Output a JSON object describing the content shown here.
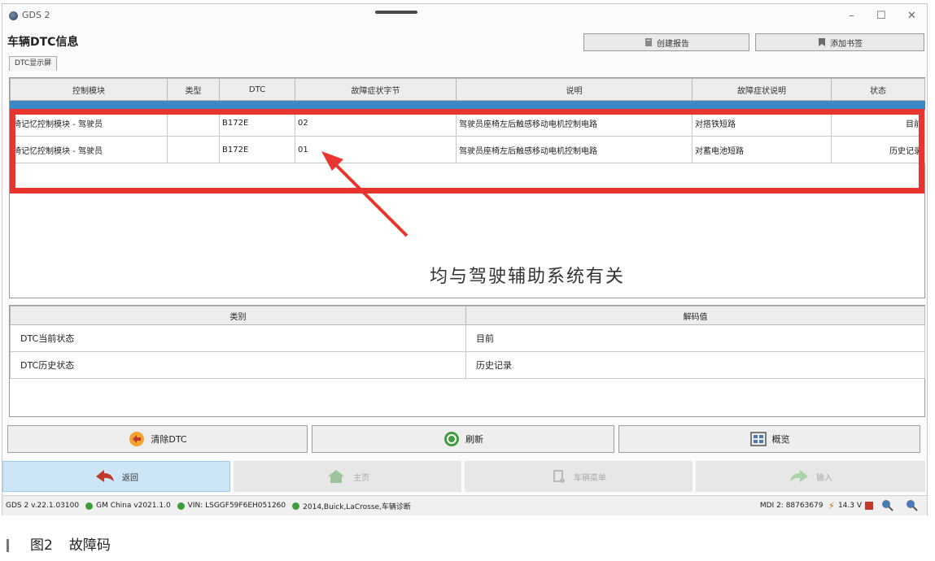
{
  "window": {
    "title": "GDS 2",
    "minimize": "–",
    "maximize": "☐",
    "close": "✕"
  },
  "page_title": "车辆DTC信息",
  "top_buttons": {
    "create_report": "创建报告",
    "add_bookmark": "添加书签"
  },
  "tab_label": "DTC显示屏",
  "dtc_table": {
    "headers": [
      "控制模块",
      "类型",
      "DTC",
      "故障症状字节",
      "说明",
      "故障症状说明",
      "状态"
    ],
    "rows": [
      {
        "module": "椅记忆控制模块 - 驾驶员",
        "type": "",
        "dtc": "B172E",
        "byte": "02",
        "desc": "驾驶员座椅左后触感移动电机控制电路",
        "symptom": "对搭铁短路",
        "status": "目前"
      },
      {
        "module": "椅记忆控制模块 - 驾驶员",
        "type": "",
        "dtc": "B172E",
        "byte": "01",
        "desc": "驾驶员座椅左后触感移动电机控制电路",
        "symptom": "对蓄电池短路",
        "status": "历史记录"
      }
    ]
  },
  "annotation": "均与驾驶辅助系统有关",
  "info_table": {
    "headers": [
      "类别",
      "解码值"
    ],
    "rows": [
      {
        "category": "DTC当前状态",
        "value": "目前"
      },
      {
        "category": "DTC历史状态",
        "value": "历史记录"
      }
    ]
  },
  "actions": {
    "clear": "清除DTC",
    "refresh": "刷新",
    "overview": "概览"
  },
  "nav": {
    "back": "返回",
    "home": "主页",
    "vehicle_menu": "车辆菜单",
    "input": "输入"
  },
  "status": {
    "version": "GDS 2 v.22.1.03100",
    "db": "GM China v2021.1.0",
    "vin": "VIN: LSGGF59F6EH051260",
    "vehicle": "2014,Buick,LaCrosse,车辆诊断",
    "mdi": "MDI 2: 88763679",
    "voltage": "14.3 V"
  },
  "caption": {
    "figure": "图2",
    "text": "故障码"
  },
  "colors": {
    "highlight": "#e8352f",
    "selected_row": "#3a88c5",
    "status_dot": "#3e9b3e"
  }
}
